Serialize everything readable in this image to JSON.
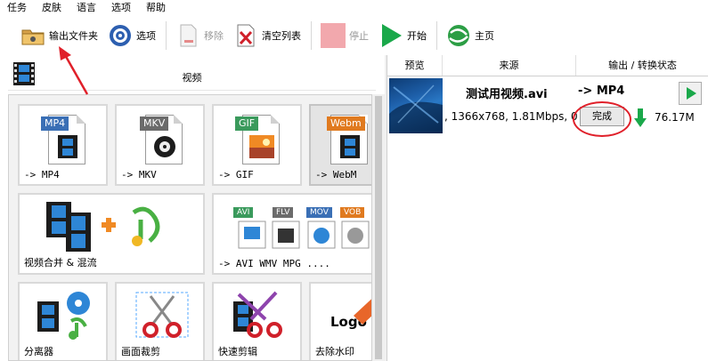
{
  "menu": [
    "任务",
    "皮肤",
    "语言",
    "选项",
    "帮助"
  ],
  "toolbar": {
    "output_folder": "输出文件夹",
    "options": "选项",
    "remove": "移除",
    "clear_list": "清空列表",
    "stop": "停止",
    "start": "开始",
    "home": "主页"
  },
  "left_panel": {
    "category_title": "视频",
    "tiles": [
      {
        "label": "-> MP4",
        "tag": "MP4",
        "tag_color": "#3a6fb5"
      },
      {
        "label": "-> MKV",
        "tag": "MKV",
        "tag_color": "#6b6b6b"
      },
      {
        "label": "-> GIF",
        "tag": "GIF",
        "tag_color": "#3a9a5c"
      },
      {
        "label": "-> WebM",
        "tag": "Webm",
        "tag_color": "#e07a1f"
      },
      {
        "label": "视频合并 & 混流"
      },
      {
        "label": "-> AVI WMV MPG ....",
        "tags": [
          "AVI",
          "FLV",
          "MOV",
          "VOB"
        ]
      },
      {
        "label": "分离器"
      },
      {
        "label": "画面裁剪"
      },
      {
        "label": "快速剪辑"
      },
      {
        "label": "去除水印",
        "logo_text": "Logo"
      }
    ]
  },
  "right_panel": {
    "columns": [
      "预览",
      "来源",
      "输出 / 转换状态"
    ],
    "rows": [
      {
        "source_name": "测试用视频.avi",
        "target": "-> MP4",
        "info": ", 1366x768, 1.81Mbps, 0",
        "status_button": "完成",
        "output_size": "76.17M"
      }
    ]
  },
  "colors": {
    "highlight_red": "#e0202a",
    "start_green": "#1aa84a",
    "stop_pink": "#f2a8ad"
  }
}
